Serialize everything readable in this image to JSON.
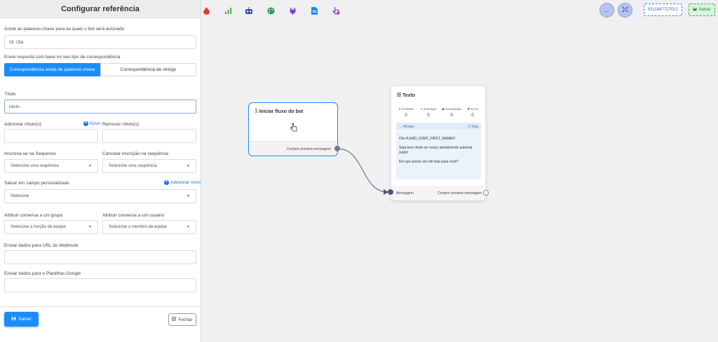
{
  "panel": {
    "title": "Configurar referência",
    "keywords_label": "Anote as palavras-chave para as quais o bot será acionado",
    "keywords_value": "Oi, Olá",
    "match_label": "Envie resposta com base no seu tipo de correspondência",
    "match_options": [
      "Correspondência exata de palavras-chave",
      "Correspondência de strings"
    ],
    "title_label": "Título",
    "title_value": "inicio",
    "add_tag_label": "Adicionar rótulo(s)",
    "new_link": "Novo",
    "remove_tag_label": "Remover rótulo(s)",
    "subscribe_label": "Inscreva-se na Sequence",
    "subscribe_placeholder": "Selecione uma sequência",
    "unsubscribe_label": "Cancelar inscrição na sequência",
    "unsubscribe_placeholder": "Selecione uma sequência",
    "custom_field_label": "Salvar em campo personalizado",
    "add_new_link": "Adicionar novo",
    "custom_field_placeholder": "Selecione",
    "group_label": "Atribuir conversa a um grupo",
    "group_placeholder": "Selecione a função da equipe",
    "user_label": "Atribuir conversa a um usuário",
    "user_placeholder": "Selecione o membro da equipe",
    "webhook_label": "Enviar dados para URL do Webhook",
    "sheets_label": "Enviar dados para o Planilhas Google",
    "save_button": "Salvar",
    "close_button": "Fechar"
  },
  "toolbar": {
    "tools": [
      "drop-icon",
      "chart-icon",
      "robot-icon",
      "palette-icon",
      "plug-icon",
      "file-icon",
      "pointer-icon"
    ],
    "phone": "5511947727012",
    "save": "Salvar"
  },
  "canvas": {
    "start_node": {
      "title": "Iniciar fluxo do bot",
      "footer": "Compor próxima mensagem"
    },
    "text_node": {
      "title": "Texto",
      "stats": [
        {
          "name": "Enviado",
          "value": "0"
        },
        {
          "name": "Entregue",
          "value": "0"
        },
        {
          "name": "Escaneado",
          "value": "0"
        },
        {
          "name": "Erros",
          "value": "0"
        }
      ],
      "delay_label": "... Atraso",
      "delay_value": "0 Seg",
      "message_lines": [
        "Olá  #LEAD_USER_FIRST_NAME#!",
        "Seja bem vindo ao nosso atendimento automat\nizado!",
        "Em que posso ser útil hoje para você?"
      ],
      "input_label": "Mensagem",
      "output_label": "Compor próxima mensagem"
    }
  },
  "colors": {
    "primary": "#1a8cff",
    "panel_bg": "#ffffff",
    "canvas_bg": "#f0f0f0"
  }
}
